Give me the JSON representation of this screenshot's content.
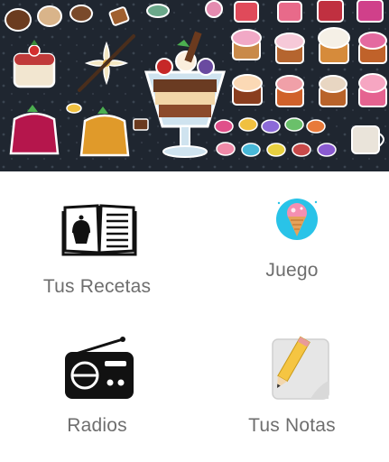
{
  "banner": {
    "icon": "desserts-illustration"
  },
  "menu": [
    {
      "label": "Tus Recetas",
      "icon": "recipe-book-icon"
    },
    {
      "label": "Juego",
      "icon": "ice-cream-icon"
    },
    {
      "label": "Radios",
      "icon": "radio-icon"
    },
    {
      "label": "Tus Notas",
      "icon": "notes-pencil-icon"
    }
  ],
  "colors": {
    "banner_bg": "#1f2630",
    "label": "#6e6e6e",
    "game_circle": "#29c3e8"
  }
}
